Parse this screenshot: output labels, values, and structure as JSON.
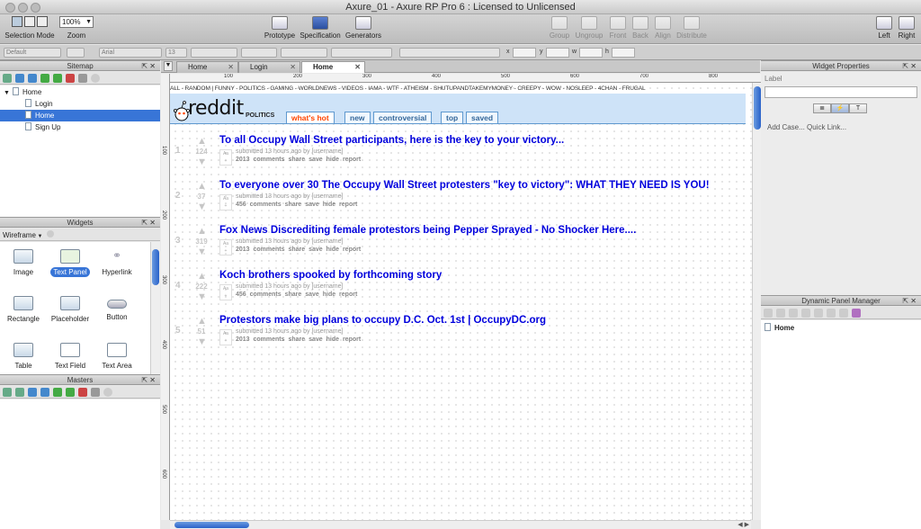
{
  "window": {
    "title": "Axure_01 - Axure RP Pro 6 : Licensed to Unlicensed"
  },
  "toolbar": {
    "selection_mode": "Selection Mode",
    "zoom_label": "Zoom",
    "zoom_value": "100%",
    "prototype": "Prototype",
    "specification": "Specification",
    "generators": "Generators",
    "group": "Group",
    "ungroup": "Ungroup",
    "front": "Front",
    "back": "Back",
    "align": "Align",
    "distribute": "Distribute",
    "left": "Left",
    "right": "Right"
  },
  "formatbar": {
    "style": "Default",
    "font": "Arial",
    "size": "13",
    "x": "x",
    "y": "y",
    "w": "w",
    "h": "h"
  },
  "sitemap": {
    "title": "Sitemap",
    "pages": [
      {
        "label": "Home"
      },
      {
        "label": "Login"
      },
      {
        "label": "Home"
      },
      {
        "label": "Sign Up"
      }
    ]
  },
  "widgets": {
    "title": "Widgets",
    "library": "Wireframe",
    "items": [
      "Image",
      "Text Panel",
      "Hyperlink",
      "Rectangle",
      "Placeholder",
      "Button",
      "Table",
      "Text Field",
      "Text Area"
    ]
  },
  "masters": {
    "title": "Masters"
  },
  "tabs": [
    {
      "label": "Home"
    },
    {
      "label": "Login"
    },
    {
      "label": "Home"
    }
  ],
  "ruler": {
    "top": [
      "100",
      "200",
      "300",
      "400",
      "500",
      "600",
      "700",
      "800",
      "900"
    ],
    "left": [
      "100",
      "200",
      "300",
      "400",
      "500",
      "600"
    ]
  },
  "reddit": {
    "topnav": "ALL - RANDOM | FUNNY - POLITICS - GAMING - WORLDNEWS - VIDEOS - IAMA - WTF - ATHEISM - SHUTUPANDTAKEMYMONEY - CREEPY - WOW - NOSLEEP - 4CHAN - FRUGAL",
    "wordmark": "reddit",
    "subreddit": "POLITICS",
    "tabs": [
      "what's hot",
      "new",
      "controversial",
      "top",
      "saved"
    ],
    "posts": [
      {
        "rank": "1",
        "score": "124",
        "title": "To all Occupy Wall Street participants, here is the key to your victory...",
        "tagline": "submitted 13 hours ago by [username]",
        "links": "2013 comments  share  save  hide  report"
      },
      {
        "rank": "2",
        "score": "37",
        "title": "To everyone over 30 The Occupy Wall Street protesters \"key to victory\": WHAT THEY NEED IS YOU!",
        "tagline": "submitted 13 hours ago by [username]",
        "links": "456 comments  share  save  hide  report"
      },
      {
        "rank": "3",
        "score": "319",
        "title": "Fox News Discrediting female protestors being Pepper Sprayed - No Shocker Here....",
        "tagline": "submitted 13 hours ago by [username]",
        "links": "2013 comments  share  save  hide  report"
      },
      {
        "rank": "4",
        "score": "222",
        "title": "Koch brothers spooked by forthcoming story",
        "tagline": "submitted 13 hours ago by [username]",
        "links": "456 comments  share  save  hide  report"
      },
      {
        "rank": "5",
        "score": "51",
        "title": "Protestors make big plans to occupy D.C. Oct. 1st | OccupyDC.org",
        "tagline": "submitted 13 hours ago by [username]",
        "links": "2013 comments  share  save  hide  report"
      }
    ]
  },
  "widget_properties": {
    "title": "Widget Properties",
    "label": "Label",
    "links": "Add Case...  Quick Link..."
  },
  "dynamic_panel_manager": {
    "title": "Dynamic Panel Manager",
    "item": "Home"
  }
}
